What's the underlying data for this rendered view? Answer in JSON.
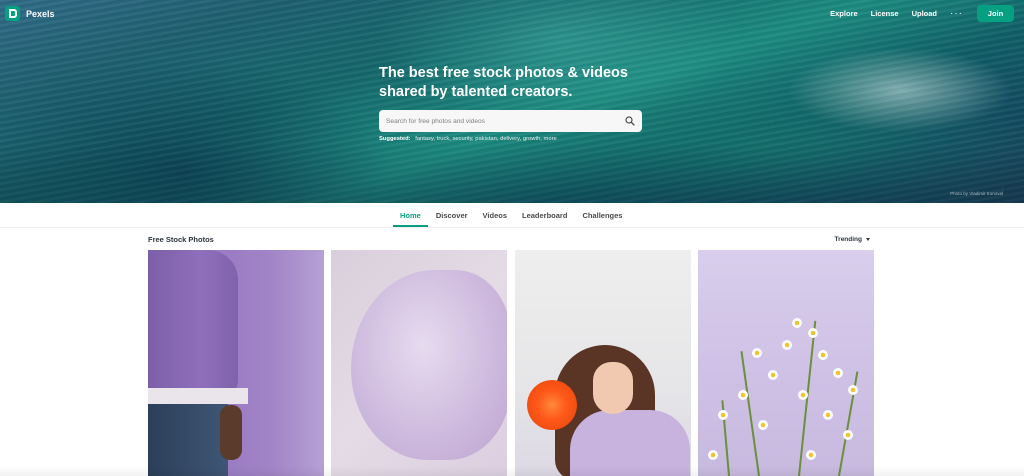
{
  "nav": {
    "brand": "Pexels",
    "links": [
      "Explore",
      "License",
      "Upload"
    ],
    "more": "···",
    "join": "Join"
  },
  "hero": {
    "title_line1": "The best free stock photos & videos",
    "title_line2": "shared by talented creators.",
    "search_placeholder": "Search for free photos and videos",
    "suggested_label": "Suggested:",
    "suggestions": [
      "fantasy",
      "truck",
      "security",
      "pakistan",
      "delivery",
      "growth",
      "more"
    ],
    "photo_credit": "Photo by Vladimir Konoval"
  },
  "tabs": [
    "Home",
    "Discover",
    "Videos",
    "Leaderboard",
    "Challenges"
  ],
  "active_tab": "Home",
  "section": {
    "title": "Free Stock Photos",
    "sort": "Trending"
  },
  "colors": {
    "accent": "#05a081",
    "text": "#2c343e"
  }
}
